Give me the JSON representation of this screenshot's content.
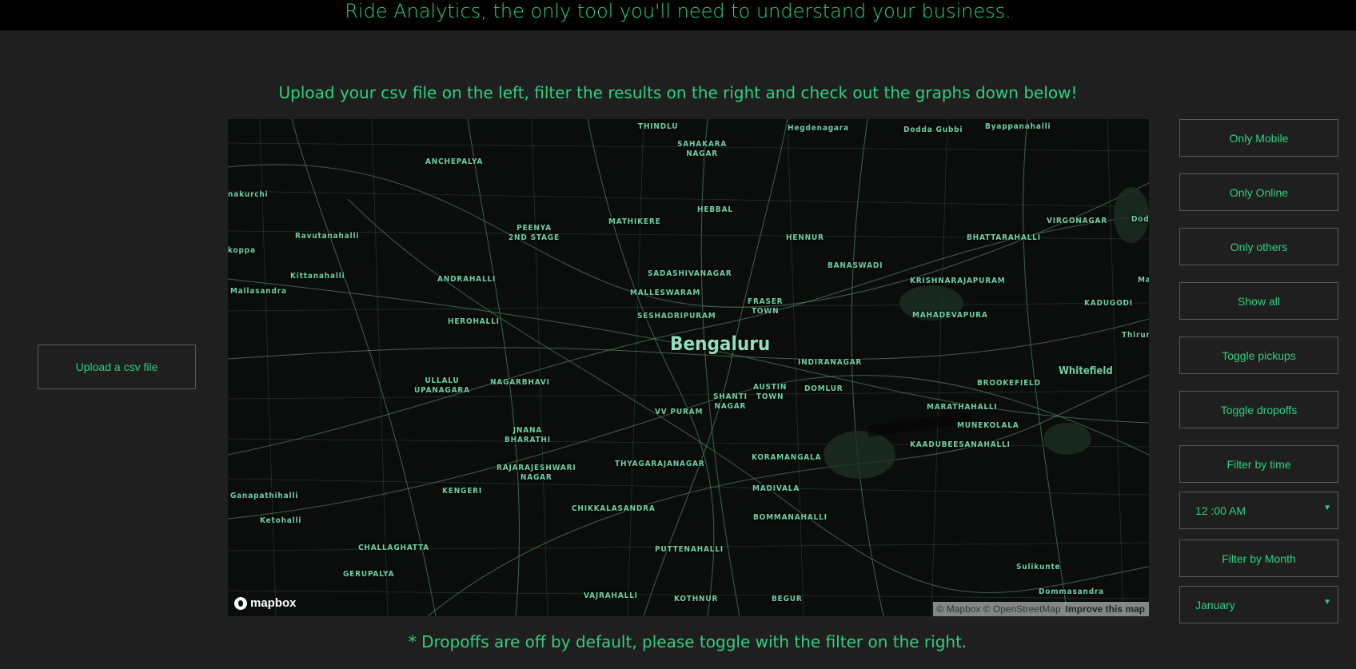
{
  "header": {
    "title": "Ride Analytics, the only tool you'll need to understand your business."
  },
  "subtitle": "Upload your csv file on the left, filter the results on the right and check out the graphs down below!",
  "footnote": "* Dropoffs are off by default, please toggle with the filter on the right.",
  "upload": {
    "label": "Upload a csv file"
  },
  "filters": {
    "only_mobile": "Only Mobile",
    "only_online": "Only Online",
    "only_others": "Only others",
    "show_all": "Show all",
    "toggle_pickups": "Toggle pickups",
    "toggle_dropoffs": "Toggle dropoffs",
    "filter_by_time": "Filter by time",
    "time_value": "12 :00 AM",
    "filter_by_month": "Filter by Month",
    "month_value": "January"
  },
  "map": {
    "city": "Bengaluru",
    "logo": "mapbox",
    "attribution": "© Mapbox © OpenStreetMap",
    "improve": "Improve this map",
    "places": {
      "thindlu": "THINDLU",
      "hegdenagara": "Hegdenagara",
      "dodda_gubbi": "Dodda Gubbi",
      "byappanahalli": "Byappanahalli",
      "sahakara_nagar": "SAHAKARA\nNAGAR",
      "anchepalya": "ANCHEPALYA",
      "nakurchi": "nakurchi",
      "hebbal": "HEBBAL",
      "virgonagar": "VIRGONAGAR",
      "doddo": "Dodd",
      "mathikere": "MATHIKERE",
      "peenya": "PEENYA\n2ND STAGE",
      "ravutanahalli": "Ravutanahalli",
      "hennur": "HENNUR",
      "bhattarahalli": "BHATTARAHALLI",
      "koppa": "koppa",
      "banaswadi": "BANASWADI",
      "kittanahalli": "Kittanahalli",
      "andrahalli": "ANDRAHALLI",
      "sadashivanagar": "SADASHIVANAGAR",
      "krishnarajapuram": "KRISHNARAJAPURAM",
      "ma": "Ma",
      "mallasandra": "Mallasandra",
      "malleswaram": "MALLESWARAM",
      "fraser_town": "FRASER\nTOWN",
      "kadugodi": "KADUGODI",
      "seshadripuram": "SESHADRIPURAM",
      "mahadevapura": "MAHADEVAPURA",
      "herohalli": "HEROHALLI",
      "thirum": "Thirum",
      "indiranagar": "INDIRANAGAR",
      "whitefield": "Whitefield",
      "ullalu": "ULLALU\nUPANAGARA",
      "nagarbhavi": "NAGARBHAVI",
      "austin_town": "AUSTIN\nTOWN",
      "domlur": "DOMLUR",
      "brookefield": "BROOKEFIELD",
      "shanti_nagar": "SHANTI\nNAGAR",
      "vv_puram": "VV PURAM",
      "marathahalli": "MARATHAHALLI",
      "munekolala": "MUNEKOLALA",
      "jnana_bharathi": "JNANA\nBHARATHI",
      "kaadubeesanahalli": "KAADUBEESANAHALLI",
      "koramangala": "KORAMANGALA",
      "thyagarajanagar": "THYAGARAJANAGAR",
      "rajarajeshwari": "RAJARAJESHWARI\nNAGAR",
      "kengeri": "KENGERI",
      "madivala": "MADIVALA",
      "ganapathihalli": "Ganapathihalli",
      "chikkalasandra": "CHIKKALASANDRA",
      "bommanahalli": "BOMMANAHALLI",
      "ketohalli": "Ketohalli",
      "challaghatta": "CHALLAGHATTA",
      "puttenahalli": "PUTTENAHALLI",
      "sulikunte": "Sulikunte",
      "gerupalya": "GERUPALYA",
      "dommasandra": "Dommasandra",
      "vajrahalli": "VAJRAHALLI",
      "kothnur": "KOTHNUR",
      "begur": "BEGUR"
    }
  }
}
